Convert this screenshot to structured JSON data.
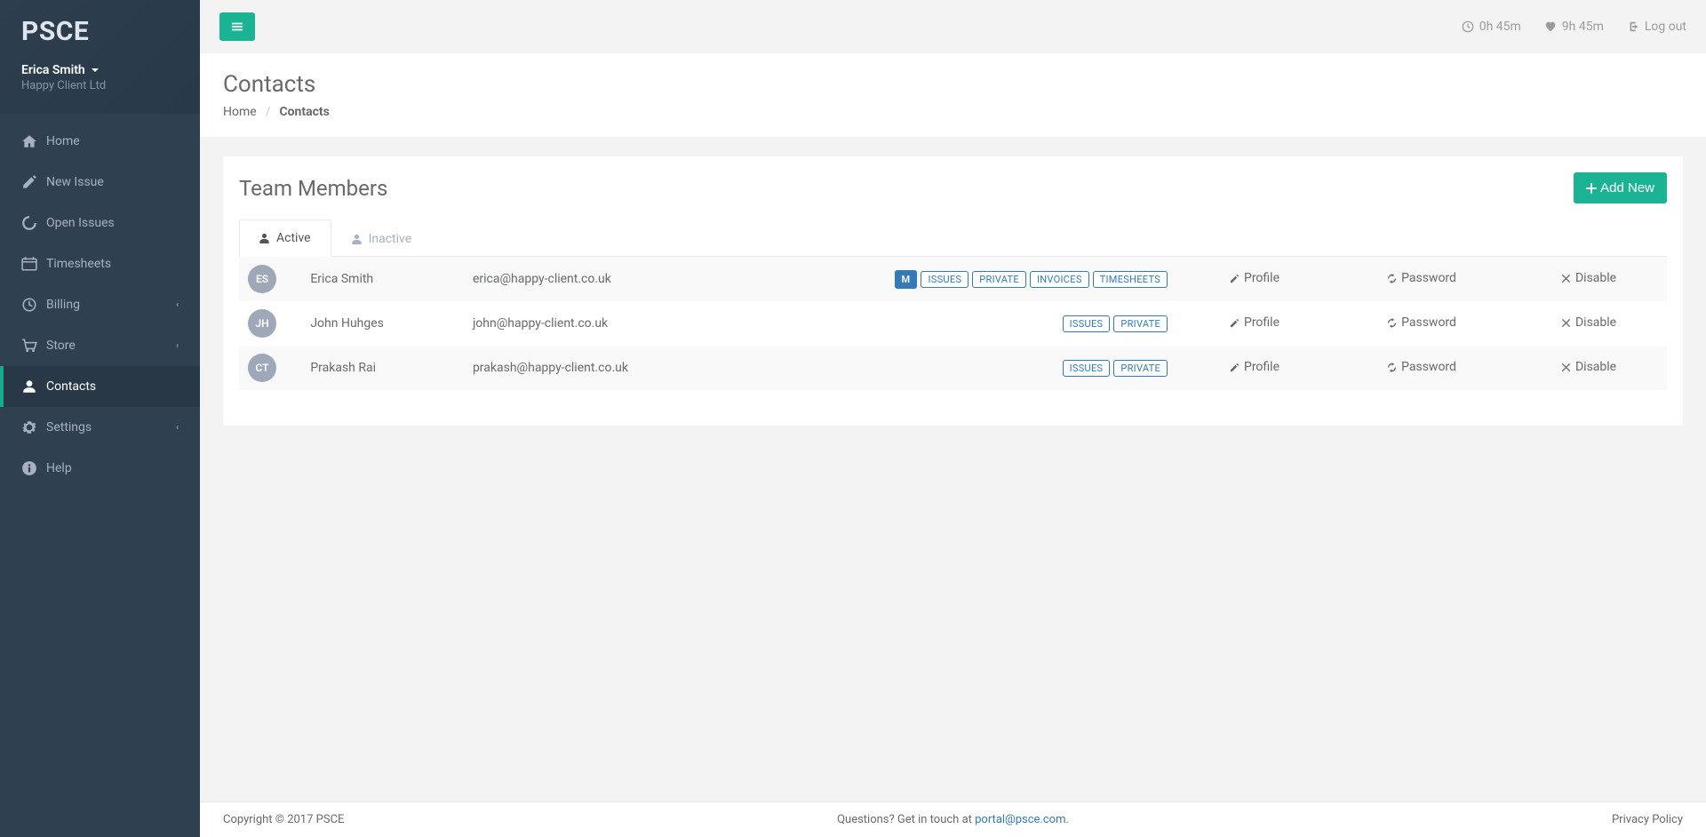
{
  "brand": "PSCE",
  "user": {
    "name": "Erica Smith",
    "company": "Happy Client Ltd"
  },
  "topbar": {
    "timer1": "0h 45m",
    "timer2": "9h 45m",
    "logout": "Log out"
  },
  "nav": [
    {
      "id": "home",
      "label": "Home",
      "icon": "home",
      "expandable": false
    },
    {
      "id": "new-issue",
      "label": "New Issue",
      "icon": "edit",
      "expandable": false
    },
    {
      "id": "open-issues",
      "label": "Open Issues",
      "icon": "spinner",
      "expandable": false
    },
    {
      "id": "timesheets",
      "label": "Timesheets",
      "icon": "calendar",
      "expandable": false
    },
    {
      "id": "billing",
      "label": "Billing",
      "icon": "clock",
      "expandable": true
    },
    {
      "id": "store",
      "label": "Store",
      "icon": "cart",
      "expandable": true
    },
    {
      "id": "contacts",
      "label": "Contacts",
      "icon": "user",
      "expandable": false,
      "active": true
    },
    {
      "id": "settings",
      "label": "Settings",
      "icon": "gear",
      "expandable": true
    },
    {
      "id": "help",
      "label": "Help",
      "icon": "info",
      "expandable": false
    }
  ],
  "page": {
    "title": "Contacts",
    "breadcrumb": {
      "home": "Home",
      "current": "Contacts"
    }
  },
  "panel": {
    "title": "Team Members",
    "add_label": "Add New",
    "tabs": {
      "active": "Active",
      "inactive": "Inactive"
    },
    "actions": {
      "profile": "Profile",
      "password": "Password",
      "disable": "Disable"
    },
    "badge_labels": {
      "m": "M",
      "issues": "ISSUES",
      "private": "PRIVATE",
      "invoices": "INVOICES",
      "timesheets": "TIMESHEETS"
    },
    "rows": [
      {
        "initials": "ES",
        "name": "Erica Smith",
        "email": "erica@happy-client.co.uk",
        "badges": [
          "m",
          "issues",
          "private",
          "invoices",
          "timesheets"
        ]
      },
      {
        "initials": "JH",
        "name": "John Huhges",
        "email": "john@happy-client.co.uk",
        "badges": [
          "issues",
          "private"
        ]
      },
      {
        "initials": "CT",
        "name": "Prakash Rai",
        "email": "prakash@happy-client.co.uk",
        "badges": [
          "issues",
          "private"
        ]
      }
    ]
  },
  "footer": {
    "copyright": "Copyright © 2017 PSCE",
    "question_prefix": "Questions? Get in touch at ",
    "email": "portal@psce.com",
    "question_suffix": ".",
    "privacy": "Privacy Policy"
  }
}
